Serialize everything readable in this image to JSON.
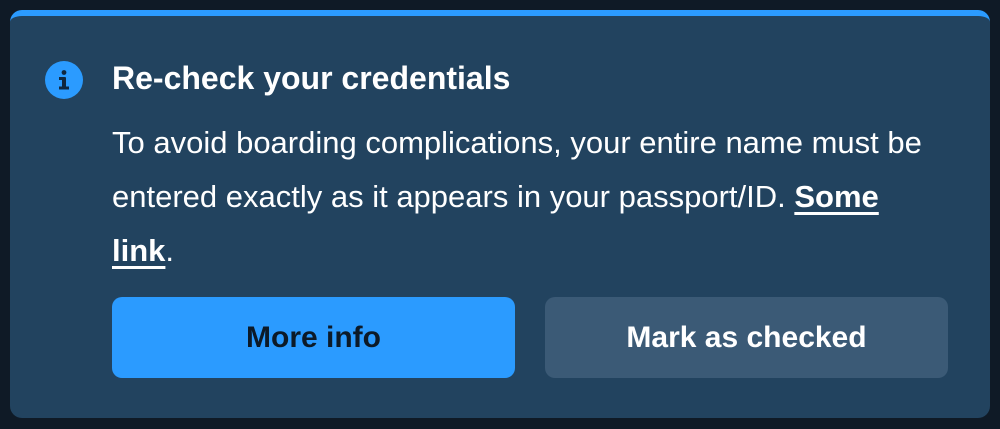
{
  "alert": {
    "icon": "info-icon",
    "title": "Re-check your credentials",
    "message_before_link": "To avoid boarding complications, your entire name must be entered exactly as it appears in your passport/ID. ",
    "link_text": "Some link",
    "message_after_link": ".",
    "primary_button": "More info",
    "secondary_button": "Mark as checked"
  },
  "colors": {
    "accent": "#2b9bff",
    "panel_background": "#22435f",
    "page_background": "#0f1a26",
    "secondary_button": "#3b5a76"
  }
}
